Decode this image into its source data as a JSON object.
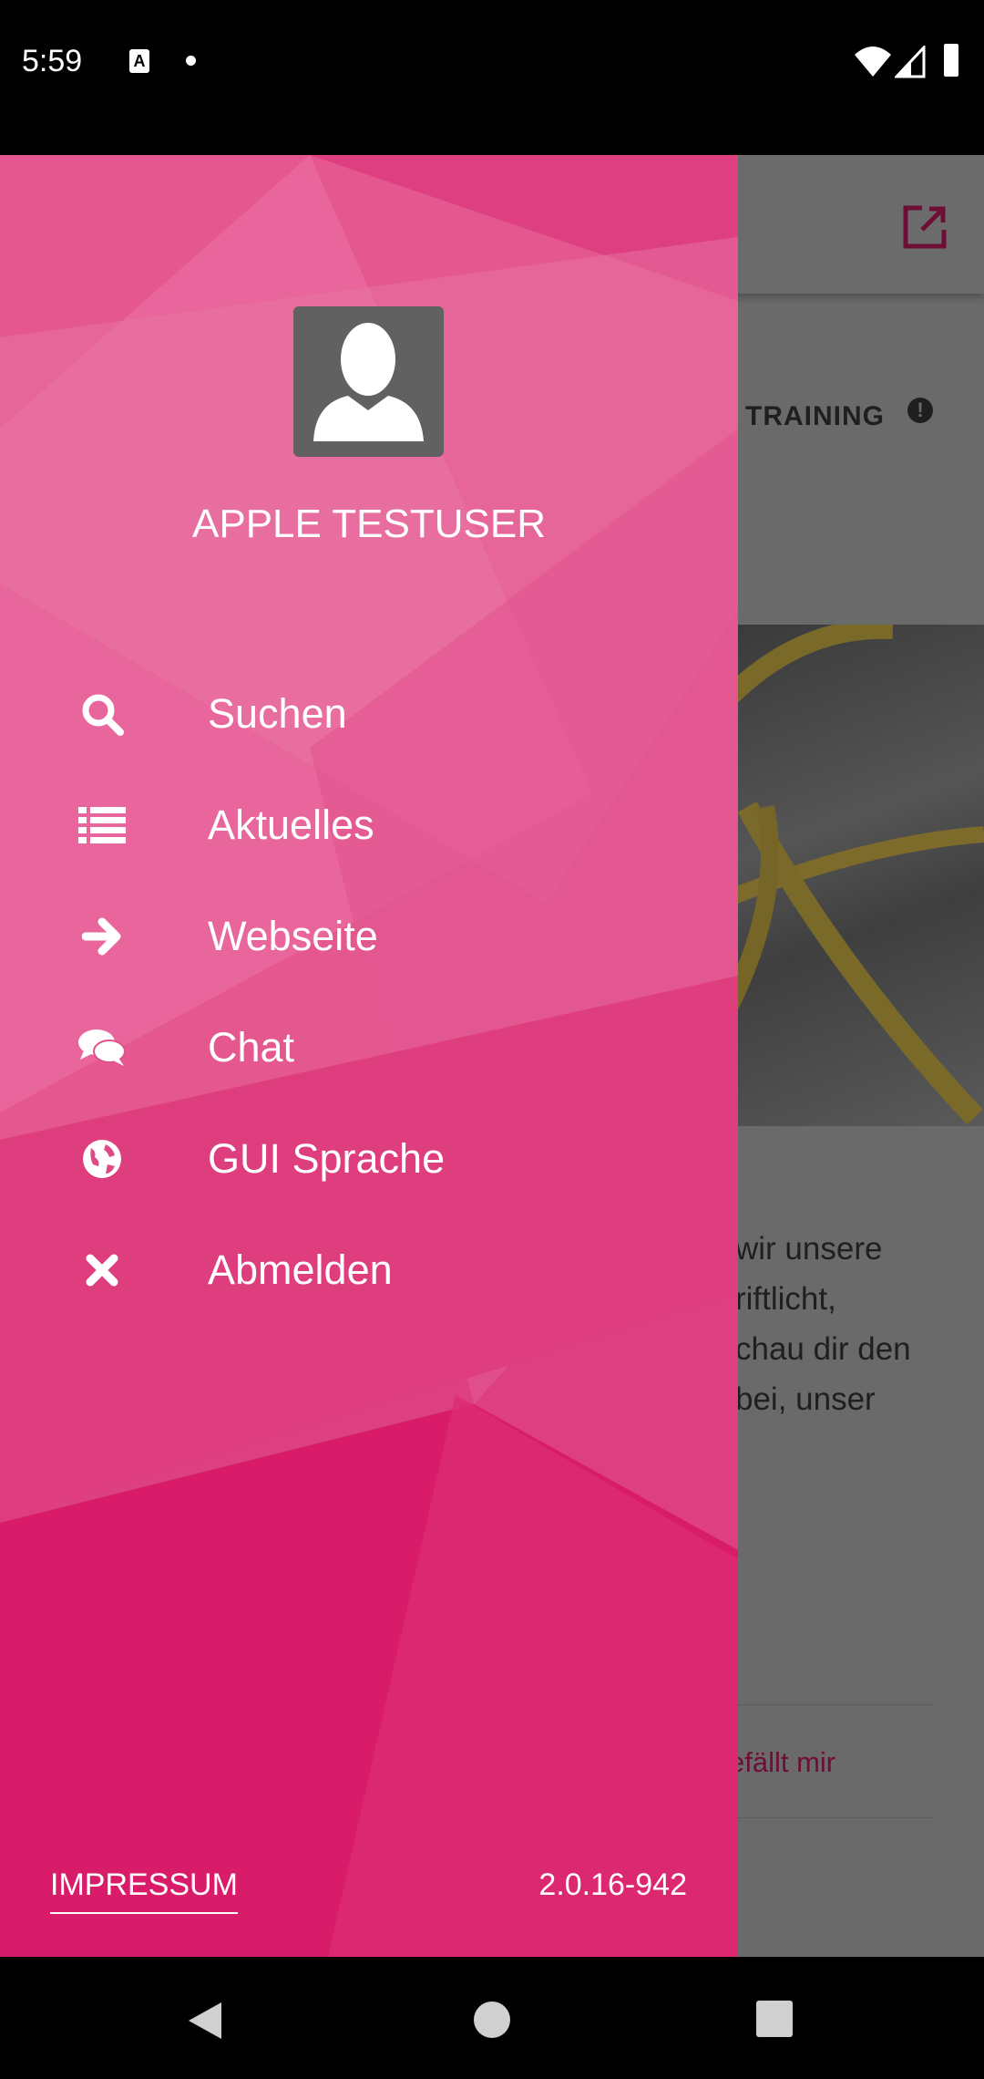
{
  "status_bar": {
    "time": "5:59",
    "icons": [
      "accessibility-a-icon",
      "dot-icon",
      "wifi-icon",
      "signal-icon",
      "battery-icon"
    ]
  },
  "background": {
    "appbar_icon": "open-external-icon",
    "card_title": "TRAINING",
    "card_icon": "alert-icon",
    "body_lines": [
      "wir unsere",
      "riftlicht,",
      "chau dir den",
      "bei, unser"
    ],
    "like_label": "efällt mir",
    "accent": "#8a1446"
  },
  "drawer": {
    "user_name": "APPLE TESTUSER",
    "colors": {
      "base": "#dd3f80",
      "light": "#e9699f",
      "dark": "#d81b6a"
    },
    "items": [
      {
        "label": "Suchen",
        "icon": "search-icon"
      },
      {
        "label": "Aktuelles",
        "icon": "list-icon"
      },
      {
        "label": "Webseite",
        "icon": "arrow-right-icon"
      },
      {
        "label": "Chat",
        "icon": "chat-icon"
      },
      {
        "label": "GUI Sprache",
        "icon": "globe-icon"
      },
      {
        "label": "Abmelden",
        "icon": "close-icon"
      }
    ],
    "impressum": "IMPRESSUM",
    "version": "2.0.16-942"
  },
  "nav_bar": {
    "buttons": [
      "back",
      "home",
      "recents"
    ]
  }
}
